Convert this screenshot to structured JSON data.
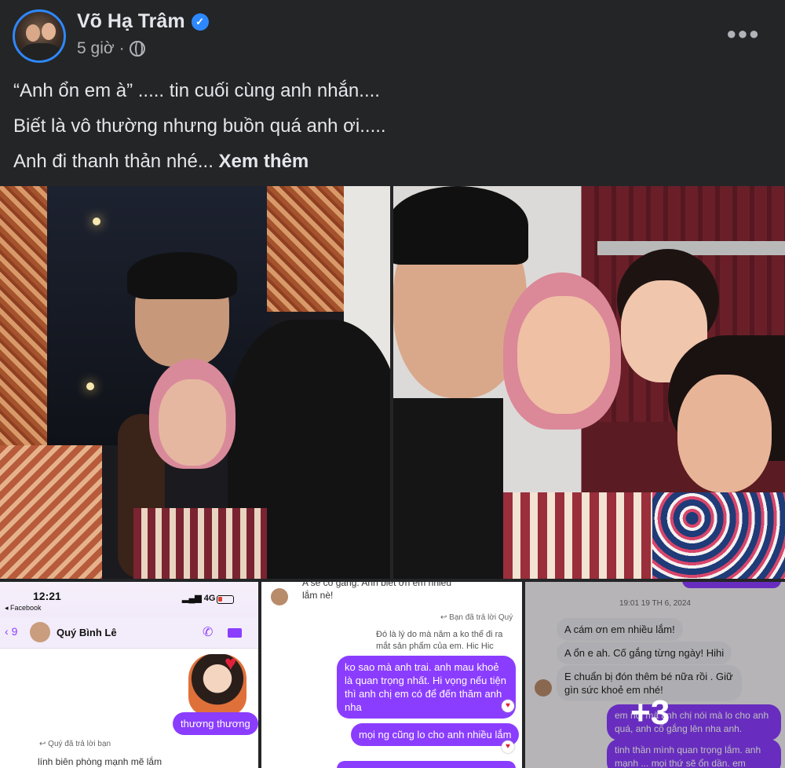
{
  "post": {
    "author": "Võ Hạ Trâm",
    "time": "5 giờ",
    "privacy_icon": "globe-icon",
    "more_icon": "more-icon",
    "verified_icon": "verified-badge-icon",
    "text_lines": [
      "“Anh ổn em à” ..... tin cuối cùng anh nhắn....",
      "Biết là vô thường nhưng buồn quá anh ơi.....",
      "Anh đi thanh thản nhé..."
    ],
    "see_more": "Xem thêm"
  },
  "chat1": {
    "time": "12:21",
    "back_app": "◂ Facebook",
    "network": "4G",
    "back_count": "9",
    "contact": "Quý Bình Lê",
    "msg_out": "thương thương",
    "note": "Quý đã trả lời bạn",
    "cut_text": "lính biên phòng mạnh mẽ lắm"
  },
  "chat2": {
    "top_line1": "A sẽ cố gắng. Anh biết ơn em nhiều",
    "top_line2": "lắm nè!",
    "note": "Bạn đã trả lời Quý",
    "quote": "Đó là lý do mà năm a ko thể đi ra mắt sản phẩm của em. Hic Hic",
    "msg_out1": "ko sao mà anh trai. anh mau khoẻ là quan trọng nhất. Hi vọng nếu tiện thì anh chị em có để đến thăm anh nha",
    "msg_out2": "mọi ng cũng lo cho anh nhiều lắm"
  },
  "chat3": {
    "stamp": "19:01 19 TH 6, 2024",
    "msg_in1": "A cám ơn em nhiều lắm!",
    "msg_in2": "A ổn e ah. Cố gắng từng ngày! Hihi",
    "msg_in3": "E chuẩn bị đón thêm bé nữa rồi . Giữ gìn sức khoẻ em nhé!",
    "msg_out1": "em nói mà anh chị nói mà lo cho anh quá, anh cố gắng lên nha anh.",
    "msg_out2": "tinh thần mình quan trọng lắm. anh mạnh ... mọi thứ sẽ ổn dần. em"
  },
  "more_photos": "+3",
  "colors": {
    "background": "#242526",
    "text": "#e4e6eb",
    "secondary": "#b0b3b8",
    "verified": "#2d88ff",
    "messenger_purple": "#8b3dff"
  }
}
